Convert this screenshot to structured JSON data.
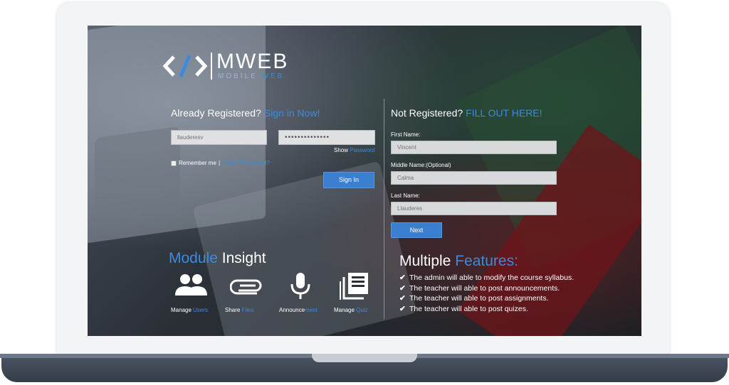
{
  "logo": {
    "title": "MWEB",
    "subtitle_mobile": "MOBILE",
    "subtitle_web": "WEB"
  },
  "sign_in": {
    "heading": "Already Registered?",
    "heading_accent": "Sign in Now!",
    "username_value": "llauderesv",
    "password_value": "••••••••••••••",
    "show_label": "Show",
    "password_link": "Password",
    "remember_label": "Remember me",
    "separator": "|",
    "forgot_link": "Forgot Password?",
    "button": "Sign In"
  },
  "register": {
    "heading": "Not Registered?",
    "heading_accent": "FILL OUT HERE!",
    "first_name_label": "First Name:",
    "first_name_value": "Vincent",
    "middle_name_label": "Middle Name:(Optional)",
    "middle_name_value": "Calma",
    "last_name_label": "Last Name:",
    "last_name_value": "Llauderes",
    "button": "Next"
  },
  "modules": {
    "title_accent": "Module",
    "title_rest": "Insight",
    "items": [
      {
        "prefix": "Manage",
        "accent": "Users",
        "icon": "users-icon"
      },
      {
        "prefix": "Share",
        "accent": "Files",
        "icon": "paperclip-icon"
      },
      {
        "prefix": "Announce",
        "accent": "ment",
        "icon": "microphone-icon"
      },
      {
        "prefix": "Manage",
        "accent": "Quiz",
        "icon": "quiz-icon"
      }
    ]
  },
  "features": {
    "title_rest": "Multiple",
    "title_accent": "Features:",
    "items": [
      "The admin will able to modify the course syllabus.",
      "The teacher will able to post announcements.",
      "The teacher will able to post assignments.",
      "The teacher will able to post quizes."
    ]
  },
  "colors": {
    "accent": "#3a8be0",
    "button": "#3a7fd0"
  }
}
